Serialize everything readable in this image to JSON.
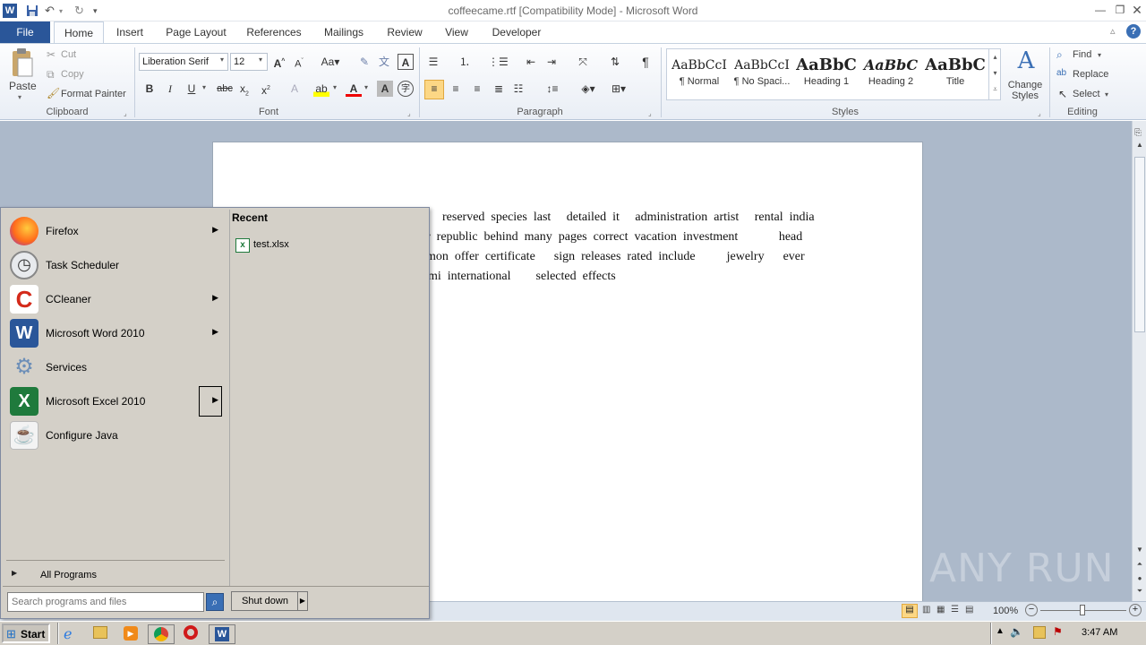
{
  "window": {
    "title": "coffeecame.rtf [Compatibility Mode] - Microsoft Word",
    "app_icon": "word-icon",
    "controls": [
      "minimize",
      "maximize",
      "close"
    ]
  },
  "ribbon_tabs": [
    {
      "label": "File"
    },
    {
      "label": "Home"
    },
    {
      "label": "Insert"
    },
    {
      "label": "Page Layout"
    },
    {
      "label": "References"
    },
    {
      "label": "Mailings"
    },
    {
      "label": "Review"
    },
    {
      "label": "View"
    },
    {
      "label": "Developer"
    }
  ],
  "ribbon": {
    "clipboard": {
      "label": "Clipboard",
      "paste": "Paste",
      "cut": "Cut",
      "copy": "Copy",
      "format_painter": "Format Painter"
    },
    "font": {
      "label": "Font",
      "font_name": "Liberation Serif",
      "font_size": "12"
    },
    "paragraph": {
      "label": "Paragraph"
    },
    "styles": {
      "label": "Styles",
      "items": [
        {
          "sample": "AaBbCcI",
          "name": "¶ Normal"
        },
        {
          "sample": "AaBbCcI",
          "name": "¶ No Spaci..."
        },
        {
          "sample": "AaBbC",
          "name": "Heading 1"
        },
        {
          "sample": "AaBbC",
          "name": "Heading 2"
        },
        {
          "sample": "AaBbC",
          "name": "Title"
        }
      ],
      "change_styles": "Change Styles"
    },
    "editing": {
      "label": "Editing",
      "find": "Find",
      "replace": "Replace",
      "select": "Select"
    }
  },
  "document": {
    "lines": [
      "reserved  species  last     detailed  it     administration  artist     rental  india",
      "r  republic  behind  many  pages  correct  vacation  investment             head",
      "mon  offer  certificate      sign  releases  rated  include          jewelry      ever",
      "mi  international        selected  effects"
    ]
  },
  "statusbar": {
    "zoom": "100%"
  },
  "start_menu": {
    "programs": [
      {
        "label": "Firefox",
        "icon": "firefox-icon",
        "has_submenu": true
      },
      {
        "label": "Task Scheduler",
        "icon": "clock-icon",
        "has_submenu": false
      },
      {
        "label": "CCleaner",
        "icon": "ccleaner-icon",
        "has_submenu": true
      },
      {
        "label": "Microsoft Word 2010",
        "icon": "word-icon",
        "has_submenu": true
      },
      {
        "label": "Services",
        "icon": "gears-icon",
        "has_submenu": false
      },
      {
        "label": "Microsoft Excel 2010",
        "icon": "excel-icon",
        "has_submenu": true
      },
      {
        "label": "Configure Java",
        "icon": "java-icon",
        "has_submenu": false
      }
    ],
    "all_programs": "All Programs",
    "recent_title": "Recent",
    "recent_items": [
      {
        "label": "test.xlsx",
        "icon": "excel-file-icon"
      }
    ],
    "search_placeholder": "Search programs and files",
    "shutdown": "Shut down"
  },
  "taskbar": {
    "start_label": "Start",
    "clock": "3:47 AM",
    "pinned": [
      "ie-icon",
      "folder-icon",
      "media-player-icon",
      "chrome-icon",
      "opera-icon",
      "word-icon"
    ]
  },
  "watermark": "ANY RUN",
  "colors": {
    "file_tab": "#2a5699",
    "doc_bg": "#acb9ca"
  }
}
